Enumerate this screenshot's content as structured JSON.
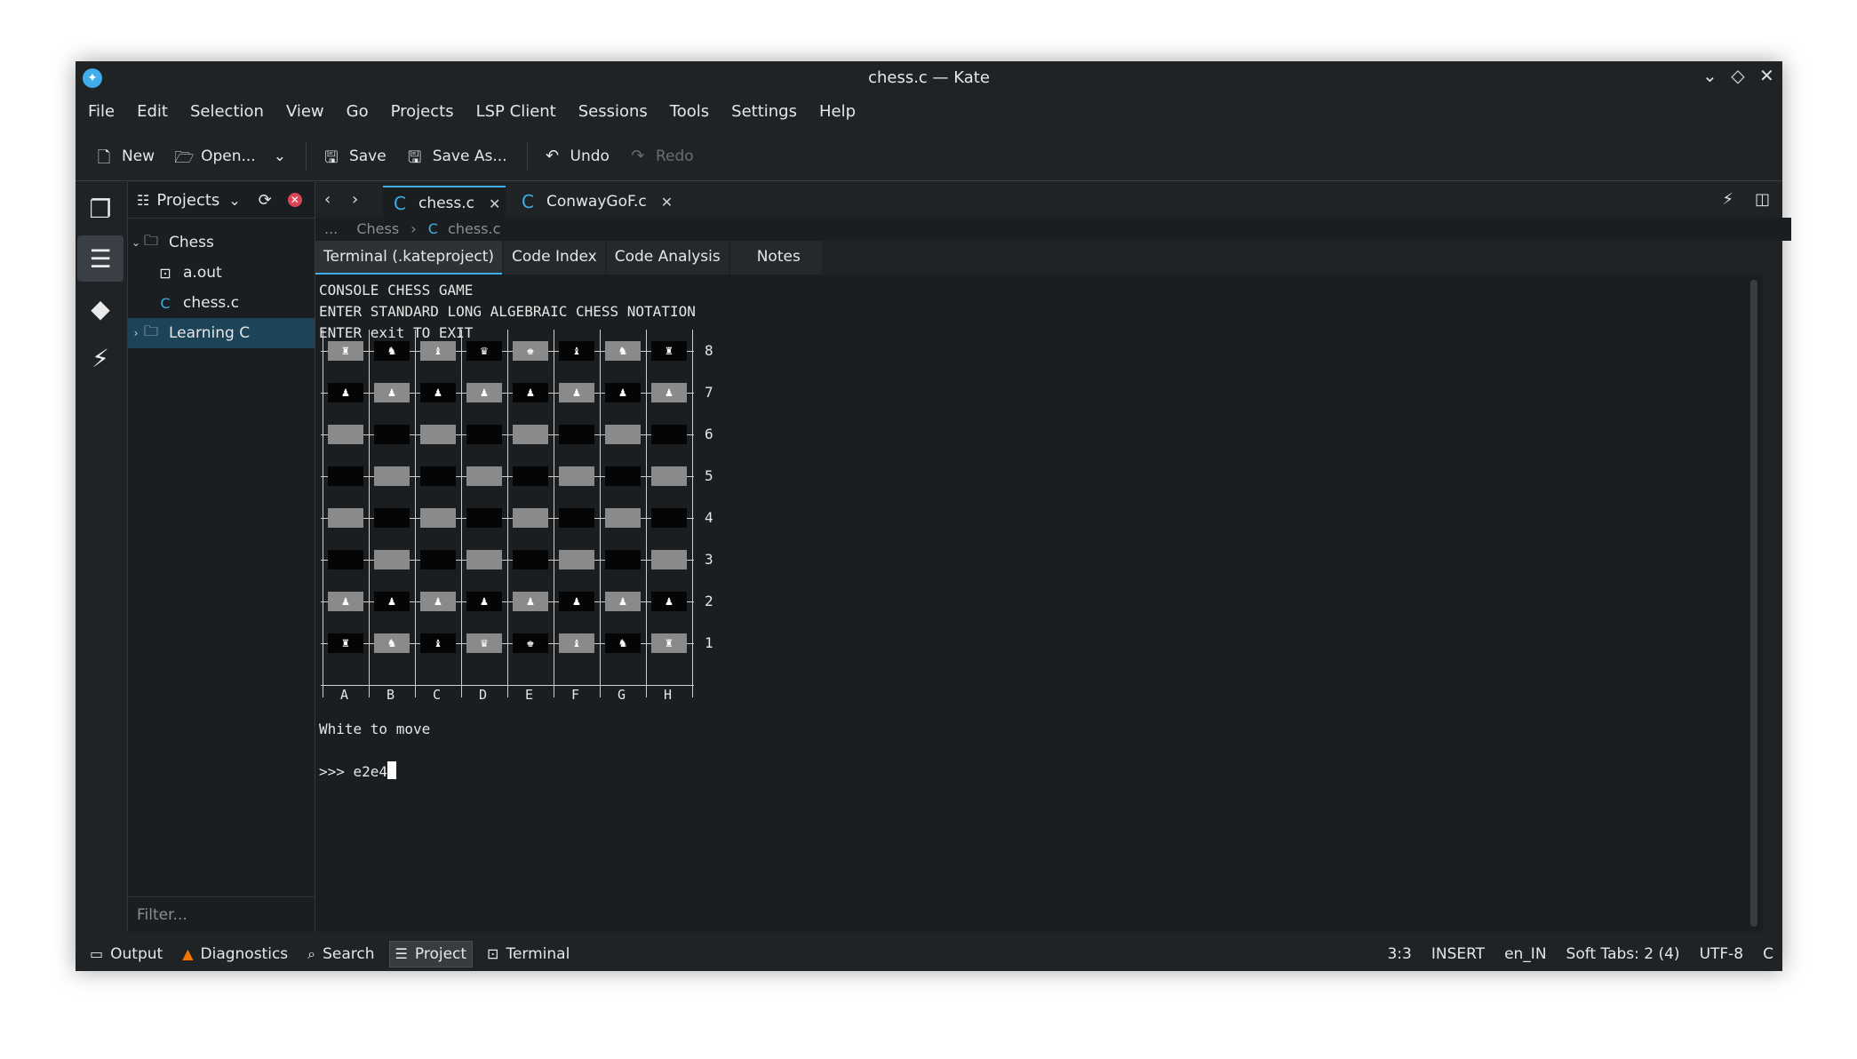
{
  "window": {
    "title": "chess.c — Kate"
  },
  "menu": [
    "File",
    "Edit",
    "Selection",
    "View",
    "Go",
    "Projects",
    "LSP Client",
    "Sessions",
    "Tools",
    "Settings",
    "Help"
  ],
  "toolbar": {
    "new_label": "New",
    "open_label": "Open...",
    "save_label": "Save",
    "save_as_label": "Save As...",
    "undo_label": "Undo",
    "redo_label": "Redo"
  },
  "sidepanel": {
    "title": "Projects",
    "tree": [
      {
        "label": "Chess",
        "icon": "folder-icon"
      },
      {
        "label": "a.out",
        "icon": "binary-file-icon"
      },
      {
        "label": "chess.c",
        "icon": "c-file-icon"
      },
      {
        "label": "Learning C",
        "icon": "folder-icon"
      }
    ],
    "filter_placeholder": "Filter..."
  },
  "tabs": [
    {
      "label": "chess.c",
      "active": true
    },
    {
      "label": "ConwayGoF.c",
      "active": false
    }
  ],
  "breadcrumb": {
    "ellipsis": "...",
    "folder": "Chess",
    "file": "chess.c"
  },
  "panel_tabs": [
    "Terminal (.kateproject)",
    "Code Index",
    "Code Analysis",
    "Notes"
  ],
  "terminal": {
    "header_lines": [
      "CONSOLE CHESS GAME",
      "ENTER STANDARD LONG ALGEBRAIC CHESS NOTATION",
      "ENTER exit TO EXIT"
    ],
    "status_line": "White to move",
    "prompt": ">>> ",
    "input": "e2e4"
  },
  "board": {
    "files": [
      "A",
      "B",
      "C",
      "D",
      "E",
      "F",
      "G",
      "H"
    ],
    "ranks": [
      "8",
      "7",
      "6",
      "5",
      "4",
      "3",
      "2",
      "1"
    ],
    "pieces": [
      [
        "♜",
        "♞",
        "♝",
        "♛",
        "♚",
        "♝",
        "♞",
        "♜"
      ],
      [
        "♟",
        "♟",
        "♟",
        "♟",
        "♟",
        "♟",
        "♟",
        "♟"
      ],
      [
        "",
        "",
        "",
        "",
        "",
        "",
        "",
        ""
      ],
      [
        "",
        "",
        "",
        "",
        "",
        "",
        "",
        ""
      ],
      [
        "",
        "",
        "",
        "",
        "",
        "",
        "",
        ""
      ],
      [
        "",
        "",
        "",
        "",
        "",
        "",
        "",
        ""
      ],
      [
        "♟",
        "♟",
        "♟",
        "♟",
        "♟",
        "♟",
        "♟",
        "♟"
      ],
      [
        "♜",
        "♞",
        "♝",
        "♛",
        "♚",
        "♝",
        "♞",
        "♜"
      ]
    ]
  },
  "statusbar": {
    "left": [
      "Output",
      "Diagnostics",
      "Search",
      "Project",
      "Terminal"
    ],
    "cursor": "3:3",
    "mode": "INSERT",
    "language": "en_IN",
    "indent": "Soft Tabs: 2 (4)",
    "encoding": "UTF-8",
    "syntax": "C"
  }
}
